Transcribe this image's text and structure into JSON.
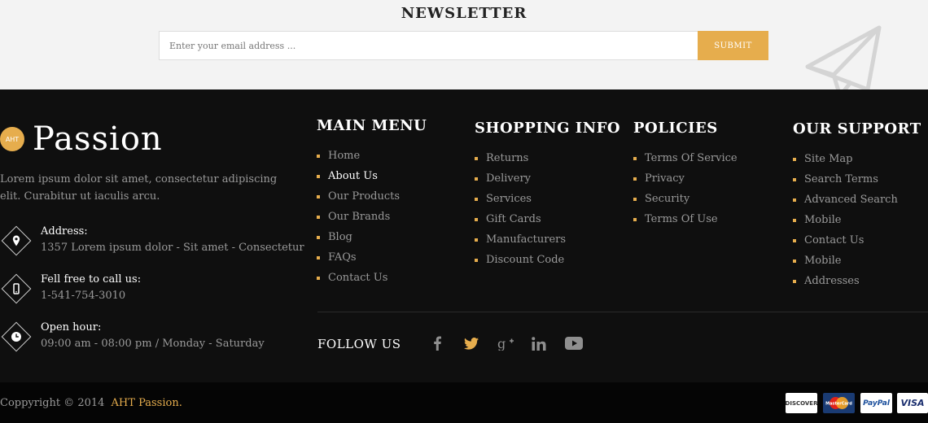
{
  "newsletter": {
    "title": "NEWSLETTER",
    "email_placeholder": "Enter your email address ...",
    "submit_label": "SUBMIT"
  },
  "brand": {
    "badge": "AHT",
    "name": "Passion",
    "description": "Lorem ipsum dolor sit amet, consectetur adipiscing elit. Curabitur ut iaculis arcu."
  },
  "contacts": [
    {
      "icon": "map-pin-icon",
      "label": "Address:",
      "value": "1357 Lorem ipsum dolor - Sit amet - Consectetur"
    },
    {
      "icon": "phone-icon",
      "label": "Fell free to call us:",
      "value": "1-541-754-3010"
    },
    {
      "icon": "clock-icon",
      "label": "Open hour:",
      "value": "09:00 am - 08:00 pm / Monday - Saturday"
    }
  ],
  "columns": {
    "main_menu": {
      "title": "MAIN MENU",
      "items": [
        "Home",
        "About Us",
        "Our Products",
        "Our Brands",
        "Blog",
        "FAQs",
        "Contact Us"
      ]
    },
    "shopping_info": {
      "title": "SHOPPING INFO",
      "items": [
        "Returns",
        "Delivery",
        "Services",
        "Gift Cards",
        "Manufacturers",
        "Discount Code"
      ]
    },
    "policies": {
      "title": "POLICIES",
      "items": [
        "Terms Of Service",
        "Privacy",
        "Security",
        "Terms Of Use"
      ]
    },
    "our_support": {
      "title": "OUR SUPPORT",
      "items": [
        "Site Map",
        "Search Terms",
        "Advanced Search",
        "Mobile",
        "Contact Us",
        "Mobile",
        "Addresses"
      ]
    }
  },
  "follow": {
    "label": "FOLLOW US",
    "icons": [
      "facebook-icon",
      "twitter-icon",
      "google-plus-icon",
      "linkedin-icon",
      "youtube-icon"
    ]
  },
  "footer_bottom": {
    "copyright": "Coppyright © 2014",
    "brand_link": "AHT Passion.",
    "payments": [
      "DISCOVER",
      "MasterCard",
      "PayPal",
      "VISA"
    ]
  },
  "colors": {
    "accent": "#e6ad4d",
    "footer_bg": "#0f0f0f",
    "newsletter_bg": "#f3f3f3"
  }
}
